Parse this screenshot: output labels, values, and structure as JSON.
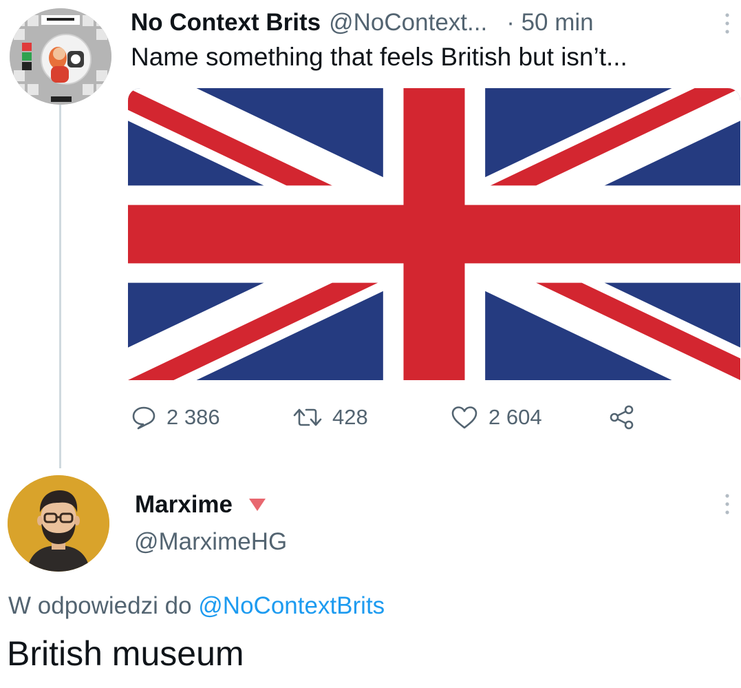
{
  "tweet": {
    "author_name": "No Context Brits",
    "author_handle": "@NoContext...",
    "time": "· 50 min",
    "text": "Name something that feels British but isn’t...",
    "image_icon": "union-jack-flag",
    "stats": {
      "replies": "2 386",
      "retweets": "428",
      "likes": "2 604"
    }
  },
  "reply": {
    "author_name": "Marxime",
    "author_handle": "@MarximeHG",
    "replying_prefix": "W odpowiedzi do",
    "replying_to_handle": "@NoContextBrits",
    "text": "British museum"
  },
  "colors": {
    "link": "#1d9bf0",
    "secondary_text": "#536471",
    "flag_red": "#d32630",
    "flag_blue": "#253b80",
    "badge": "#e8676f"
  }
}
